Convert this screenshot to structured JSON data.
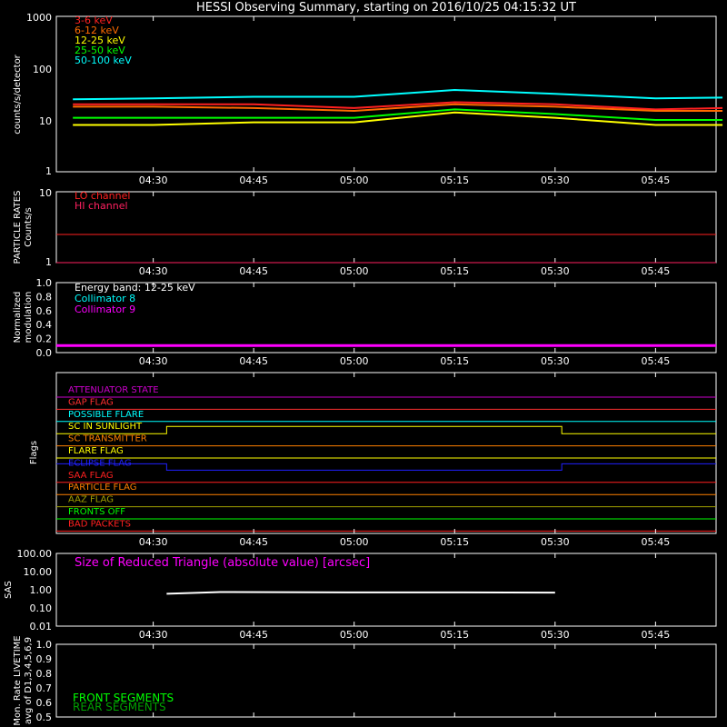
{
  "title": "HESSI Observing Summary, starting on 2016/10/25 04:15:32 UT",
  "time_ticks": [
    "04:30",
    "04:45",
    "05:00",
    "05:15",
    "05:30",
    "05:45"
  ],
  "panels": {
    "counts": {
      "ylabel": "counts/s/detector",
      "yticks": [
        "1",
        "10",
        "100",
        "1000"
      ],
      "legend": [
        {
          "label": "3-6 keV",
          "color": "#ff2020"
        },
        {
          "label": "6-12 keV",
          "color": "#ff6a00"
        },
        {
          "label": "12-25 keV",
          "color": "#ffff00"
        },
        {
          "label": "25-50 keV",
          "color": "#00ff00"
        },
        {
          "label": "50-100 keV",
          "color": "#00ffff"
        }
      ]
    },
    "particle": {
      "ylabel1": "PARTICLE RATES",
      "ylabel2": "Counts/s",
      "yticks": [
        "1",
        "10"
      ],
      "legend": [
        {
          "label": "LO channel",
          "color": "#ff2020"
        },
        {
          "label": "HI channel",
          "color": "#ff2060"
        }
      ]
    },
    "modulation": {
      "ylabel1": "Normalized",
      "ylabel2": "modulation",
      "yticks": [
        "0.0",
        "0.2",
        "0.4",
        "0.6",
        "0.8",
        "1.0"
      ],
      "legend": [
        {
          "label": "Energy band: 12-25 keV",
          "color": "#ffffff"
        },
        {
          "label": "Collimator 8",
          "color": "#00ffff"
        },
        {
          "label": "Collimator 9",
          "color": "#ff00ff"
        }
      ]
    },
    "flags": {
      "ylabel": "Flags",
      "items": [
        {
          "label": "ATTENUATOR STATE",
          "color": "#cc00cc"
        },
        {
          "label": "GAP FLAG",
          "color": "#ff3030"
        },
        {
          "label": "POSSIBLE FLARE",
          "color": "#00ffff"
        },
        {
          "label": "SC IN SUNLIGHT",
          "color": "#ffff00"
        },
        {
          "label": "SC TRANSMITTER",
          "color": "#ff8000"
        },
        {
          "label": "FLARE FLAG",
          "color": "#ffff00"
        },
        {
          "label": "ECLIPSE FLAG",
          "color": "#2020ff"
        },
        {
          "label": "SAA FLAG",
          "color": "#ff2020"
        },
        {
          "label": "PARTICLE FLAG",
          "color": "#ff8000"
        },
        {
          "label": "AAZ FLAG",
          "color": "#a0a000"
        },
        {
          "label": "FRONTS OFF",
          "color": "#00ff00"
        },
        {
          "label": "BAD PACKETS",
          "color": "#ff2020"
        }
      ]
    },
    "sas": {
      "ylabel": "SAS",
      "yticks": [
        "0.01",
        "0.10",
        "1.00",
        "10.00",
        "100.00"
      ],
      "legend": "Size of Reduced Triangle (absolute value) [arcsec]",
      "legend_color": "#ff00ff"
    },
    "livetime": {
      "ylabel1": "Mon. Rate LIVETIME",
      "ylabel2": "avg of D1,3,4,5,6,9",
      "yticks": [
        "0.5",
        "0.6",
        "0.7",
        "0.8",
        "0.9",
        "1.0"
      ],
      "legend": [
        {
          "label": "FRONT SEGMENTS",
          "color": "#00ff00"
        },
        {
          "label": "REAR SEGMENTS",
          "color": "#00a000"
        }
      ]
    }
  },
  "chart_data": [
    {
      "type": "line",
      "title": "HESSI Observing Summary, starting on 2016/10/25 04:15:32 UT",
      "ylabel": "counts/s/detector",
      "yscale": "log",
      "ylim": [
        1,
        1000
      ],
      "x_range": [
        "04:15:32",
        "05:55"
      ],
      "series": [
        {
          "name": "3-6 keV",
          "x": [
            "04:18",
            "04:30",
            "04:45",
            "05:00",
            "05:15",
            "05:30",
            "05:45",
            "05:55"
          ],
          "values": [
            20,
            20,
            20,
            17,
            22,
            20,
            16,
            17
          ]
        },
        {
          "name": "6-12 keV",
          "x": [
            "04:18",
            "04:30",
            "04:45",
            "05:00",
            "05:15",
            "05:30",
            "05:45",
            "05:55"
          ],
          "values": [
            18,
            18,
            17,
            15,
            20,
            18,
            15,
            15
          ]
        },
        {
          "name": "12-25 keV",
          "x": [
            "04:18",
            "04:30",
            "04:45",
            "05:00",
            "05:15",
            "05:30",
            "05:45",
            "05:55"
          ],
          "values": [
            8,
            8,
            9,
            9,
            14,
            11,
            8,
            8
          ]
        },
        {
          "name": "25-50 keV",
          "x": [
            "04:18",
            "04:30",
            "04:45",
            "05:00",
            "05:15",
            "05:30",
            "05:45",
            "05:55"
          ],
          "values": [
            11,
            11,
            11,
            11,
            16,
            13,
            10,
            10
          ]
        },
        {
          "name": "50-100 keV",
          "x": [
            "04:18",
            "04:30",
            "04:45",
            "05:00",
            "05:15",
            "05:30",
            "05:45",
            "05:55"
          ],
          "values": [
            25,
            26,
            28,
            28,
            38,
            32,
            26,
            27
          ]
        }
      ]
    },
    {
      "type": "line",
      "ylabel": "PARTICLE RATES Counts/s",
      "yscale": "log",
      "ylim": [
        1,
        10
      ],
      "series": [
        {
          "name": "LO channel",
          "values_range": [
            2,
            4
          ]
        },
        {
          "name": "HI channel",
          "values": [
            1,
            1
          ]
        }
      ]
    },
    {
      "type": "line",
      "ylabel": "Normalized modulation",
      "ylim": [
        0,
        1
      ],
      "series": [
        {
          "name": "Collimator 8",
          "values": [
            0.1,
            0.1
          ]
        },
        {
          "name": "Collimator 9",
          "values": [
            0.1,
            0.1
          ]
        }
      ]
    },
    {
      "type": "line",
      "ylabel": "SAS",
      "yscale": "log",
      "ylim": [
        0.01,
        100
      ],
      "series": [
        {
          "name": "Size of Reduced Triangle (absolute value) [arcsec]",
          "x": [
            "04:32",
            "04:40",
            "05:00",
            "05:15",
            "05:30"
          ],
          "values": [
            0.6,
            0.75,
            0.72,
            0.72,
            0.7
          ]
        }
      ]
    },
    {
      "type": "line",
      "ylabel": "Mon. Rate LIVETIME avg of D1,3,4,5,6,9",
      "ylim": [
        0.5,
        1.0
      ],
      "series": []
    }
  ]
}
